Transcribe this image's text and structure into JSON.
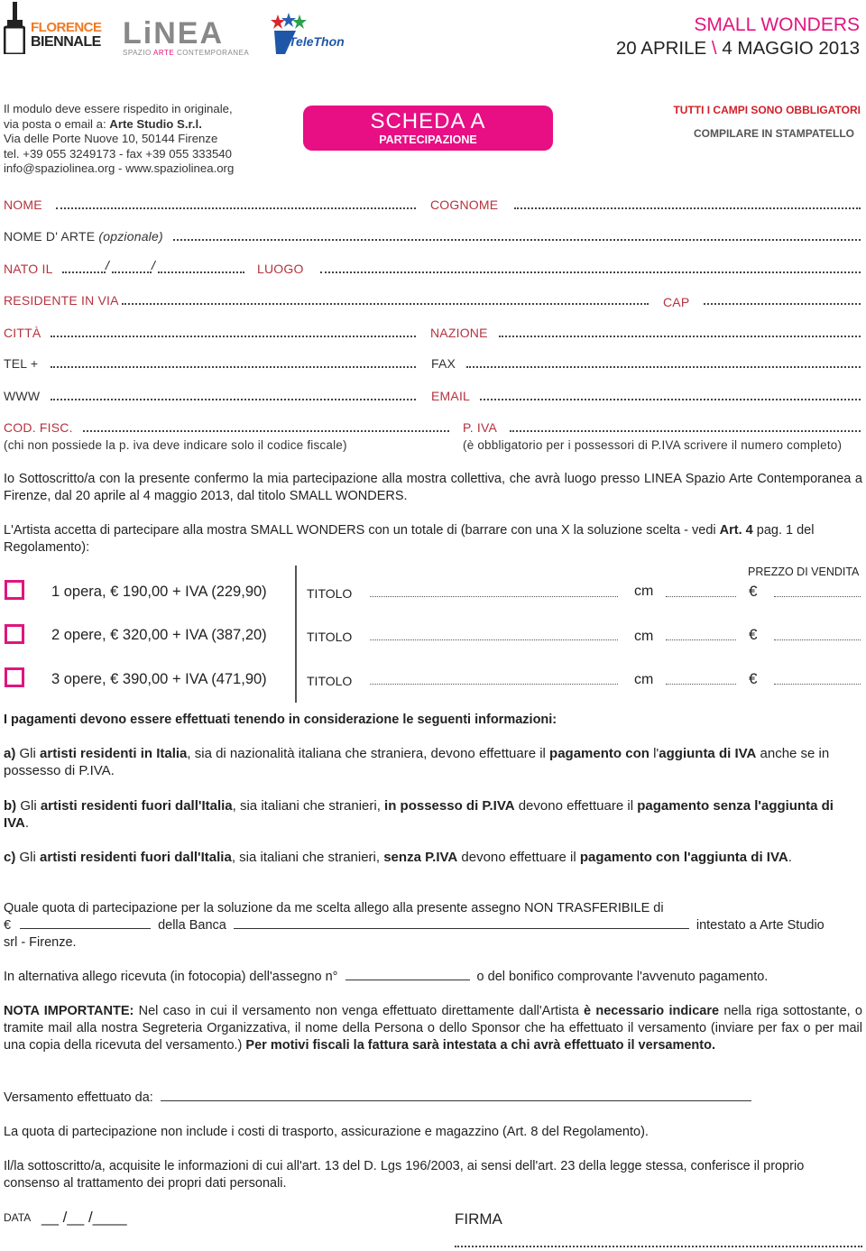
{
  "logos": {
    "florence_biennale": {
      "line1": "FLORENCE",
      "line2": "BIENNALE"
    },
    "linea": {
      "name": "LiNEA",
      "subtitle_pre": "SPAZIO ",
      "subtitle_accent": "ARTE",
      "subtitle_post": " CONTEMPORANEA"
    },
    "telethon": {
      "name": "TeleThon"
    }
  },
  "event": {
    "title": "SMALL WONDERS",
    "date_start": "20 APRILE",
    "separator": "\\",
    "date_end": "4 MAGGIO 2013"
  },
  "contact": {
    "line1": "Il modulo deve essere rispedito in originale,",
    "line2_pre": "via posta o email a: ",
    "line2_bold": "Arte Studio S.r.l.",
    "line3": "Via delle Porte Nuove 10, 50144 Firenze",
    "line4": "tel. +39 055 3249173 - fax +39 055 333540",
    "line5": "info@spaziolinea.org - www.spaziolinea.org"
  },
  "badge": {
    "title": "SCHEDA A",
    "subtitle": "PARTECIPAZIONE"
  },
  "notices": {
    "required": "TUTTI I CAMPI SONO OBBLIGATORI",
    "print": "COMPILARE IN STAMPATELLO"
  },
  "colors": {
    "accent_pink": "#e0157f",
    "label_red": "#b5323e",
    "required_red": "#d0202a"
  },
  "fields": {
    "nome": "NOME",
    "cognome": "COGNOME",
    "nome_arte": "NOME D' ARTE",
    "nome_arte_opt": "(opzionale)",
    "nato_il": "NATO IL",
    "luogo": "LUOGO",
    "residente": "RESIDENTE IN VIA",
    "cap": "CAP",
    "citta": "CITTÀ",
    "nazione": "NAZIONE",
    "tel": "TEL  +",
    "fax": "FAX",
    "www": "WWW",
    "email": "EMAIL",
    "cod_fisc": "COD. FISC.",
    "cod_fisc_note": "(chi non possiede la p. iva deve indicare solo il codice fiscale)",
    "piva": "P. IVA",
    "piva_note": "(è obbligatorio per i possessori di P.IVA scrivere il numero completo)"
  },
  "intro": {
    "p1": "Io Sottoscritto/a con la presente confermo la mia partecipazione alla mostra collettiva, che avrà luogo presso LINEA Spazio Arte Contemporanea a Firenze, dal 20 aprile al 4 maggio 2013, dal titolo SMALL WONDERS.",
    "p2_pre": "L'Artista accetta di partecipare alla mostra SMALL WONDERS con un totale di (barrare con una X la soluzione scelta - vedi ",
    "p2_bold": "Art. 4",
    "p2_post": " pag. 1 del Regolamento):"
  },
  "options": {
    "price_header": "PREZZO DI VENDITA",
    "titolo_label": "TITOLO",
    "cm_label": "cm",
    "currency": "€",
    "items": [
      {
        "label": "1 opera,  € 190,00 + IVA (229,90)",
        "checked": false
      },
      {
        "label": "2 opere,  € 320,00 + IVA (387,20)",
        "checked": false
      },
      {
        "label": "3 opere,  € 390,00 + IVA (471,90)",
        "checked": false
      }
    ]
  },
  "payments": {
    "header": "I pagamenti devono essere effettuati tenendo in considerazione le seguenti informazioni:",
    "a": {
      "letter": "a)",
      "t1": " Gli ",
      "b1": "artisti residenti in Italia",
      "t2": ", sia di nazionalità italiana che straniera, devono effettuare il ",
      "b2": "pagamento con",
      "t3": " l'",
      "b3": "aggiunta di IVA",
      "t4": " anche se in possesso di P.IVA."
    },
    "b": {
      "letter": "b)",
      "t1": " Gli ",
      "b1": "artisti residenti fuori dall'Italia",
      "t2": ", sia italiani che stranieri, ",
      "b2": "in possesso di P.IVA",
      "t3": " devono effettuare il ",
      "b3": "pagamento senza l'aggiunta di IVA",
      "t4": "."
    },
    "c": {
      "letter": "c)",
      "t1": " Gli ",
      "b1": "artisti residenti fuori dall'Italia",
      "t2": ", sia italiani che stranieri, ",
      "b2": "senza P.IVA",
      "t3": " devono effettuare il ",
      "b3": "pagamento con l'aggiunta di IVA",
      "t4": "."
    }
  },
  "cheque": {
    "line1": "Quale quota di partecipazione per la soluzione da me scelta allego alla presente assegno NON TRASFERIBILE di",
    "currency": "€",
    "bank_label": "della Banca",
    "payee": "intestato a Arte Studio srl - Firenze.",
    "alt_pre": "In alternativa allego ricevuta (in fotocopia) dell'assegno n°",
    "alt_post": "o del bonifico comprovante l'avvenuto pagamento."
  },
  "note": {
    "b1": "NOTA IMPORTANTE:",
    "t1": " Nel caso in cui il versamento non venga effettuato direttamente dall'Artista ",
    "b2": "è necessario indicare",
    "t2": " nella riga sottostante, o tramite mail alla nostra Segreteria Organizzativa, il nome della Persona o dello Sponsor che ha effettuato il versamento (inviare per fax o per mail una copia della ricevuta del versamento.) ",
    "b3": "Per motivi fiscali la fattura sarà intestata a chi avrà effettuato il versamento."
  },
  "versamento_label": "Versamento effettuato da:",
  "quota_note": "La quota di partecipazione non include i costi di trasporto, assicurazione e magazzino (Art. 8 del Regolamento).",
  "privacy": "Il/la sottoscritto/a, acquisite le informazioni di cui all'art. 13 del D. Lgs 196/2003, ai sensi dell'art. 23 della legge stessa, conferisce il proprio consenso al trattamento dei propri dati personali.",
  "footer": {
    "data_label": "DATA",
    "data_mask": "__ /__ /____",
    "firma_label": "FIRMA"
  }
}
